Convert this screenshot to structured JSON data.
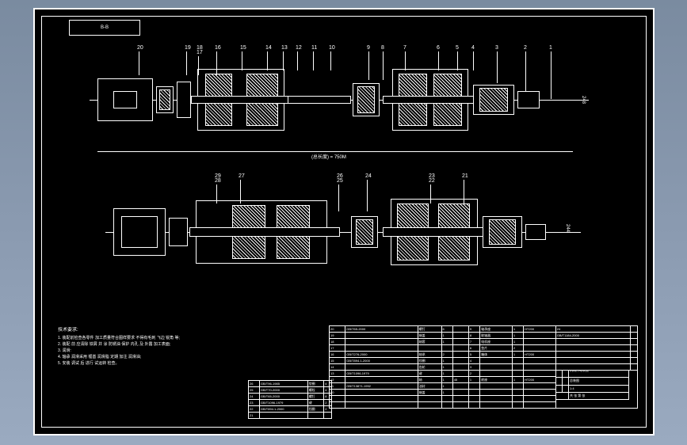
{
  "title_box": "B-B",
  "callouts_top": [
    "20",
    "19",
    "18",
    "17",
    "16",
    "15",
    "14",
    "13",
    "12",
    "11",
    "10",
    "9",
    "8",
    "7",
    "6",
    "5",
    "4",
    "3",
    "2",
    "1"
  ],
  "callouts_bottom": [
    "29",
    "28",
    "27",
    "26",
    "25",
    "24",
    "23",
    "22",
    "21"
  ],
  "dimension_label_top": "(总长度) = 750M",
  "right_dim_top": "248",
  "right_dim_bottom": "244",
  "notes_header": "技术要求:",
  "notes": [
    "1. 装配前检查各零件 加工质量符合图样要求 不得有毛刺 飞边 锐角 等;",
    "2. 装配 前 应清除 铁屑 并 涂 防锈油 保护 内孔 及 外露 加工表面;",
    "3. 润滑:",
    "4. 轴承 润滑采用 锂基 润滑脂 定期 加注 润滑油;",
    "5. 安装 调试 后 进行 试运转 检查。"
  ],
  "bom_left": [
    {
      "no": "26",
      "std": "GB/T96-1985",
      "name": "垫圈",
      "qty": "4"
    },
    {
      "no": "25",
      "std": "GB/T70-2000",
      "name": "螺栓",
      "qty": "4"
    },
    {
      "no": "24",
      "std": "GB/T65-2000",
      "name": "螺钉",
      "qty": "8"
    },
    {
      "no": "23",
      "std": "GB/T1096-1979",
      "name": "键",
      "qty": "2"
    },
    {
      "no": "22",
      "std": "GB/T894.1-2000",
      "name": "挡圈",
      "qty": "2"
    },
    {
      "no": "21",
      "std": "",
      "name": "",
      "qty": ""
    }
  ],
  "bom_main": [
    {
      "no": "20",
      "std": "GB/T65-2000",
      "name": "螺钉",
      "qty": "6",
      "mat": "",
      "note": ""
    },
    {
      "no": "19",
      "std": "",
      "name": "端盖",
      "qty": "1",
      "mat": "",
      "note": ""
    },
    {
      "no": "18",
      "std": "",
      "name": "轴套",
      "qty": "1",
      "mat": "",
      "note": ""
    },
    {
      "no": "17",
      "std": "",
      "name": "",
      "qty": "",
      "mat": "",
      "note": ""
    },
    {
      "no": "16",
      "std": "GB/T276-2000",
      "name": "轴承",
      "qty": "2",
      "mat": "",
      "note": ""
    },
    {
      "no": "15",
      "std": "GB/T894.1-2000",
      "name": "挡圈",
      "qty": "1",
      "mat": "",
      "note": ""
    },
    {
      "no": "14",
      "std": "",
      "name": "齿轮",
      "qty": "1",
      "mat": "45",
      "note": ""
    },
    {
      "no": "13",
      "std": "GB/T1096-1979",
      "name": "键",
      "qty": "1",
      "mat": "",
      "note": ""
    },
    {
      "no": "12",
      "std": "",
      "name": "轴",
      "qty": "1",
      "mat": "45",
      "note": ""
    },
    {
      "no": "11",
      "std": "GB/T13871-1992",
      "name": "油封",
      "qty": "1",
      "mat": "",
      "note": ""
    },
    {
      "no": "10",
      "std": "",
      "name": "端盖",
      "qty": "1",
      "mat": "",
      "note": ""
    }
  ],
  "bom_right": [
    {
      "no": "9",
      "name": "轴承座",
      "qty": "1",
      "mat": "HT200"
    },
    {
      "no": "8",
      "name": "联轴器",
      "qty": "1",
      "mat": ""
    },
    {
      "no": "7",
      "name": "电机座",
      "qty": "1",
      "mat": ""
    },
    {
      "no": "6",
      "name": "垫片",
      "qty": "2",
      "mat": ""
    },
    {
      "no": "5",
      "name": "箱体",
      "qty": "1",
      "mat": "HT200"
    },
    {
      "no": "4",
      "name": "",
      "qty": "",
      "mat": ""
    },
    {
      "no": "3",
      "name": "",
      "qty": "",
      "mat": ""
    },
    {
      "no": "2",
      "name": "",
      "qty": "",
      "mat": ""
    },
    {
      "no": "1",
      "name": "底座",
      "qty": "1",
      "mat": "HT200"
    }
  ],
  "bom_far_right": [
    {
      "a": "",
      "b": "24",
      "c": "",
      "d": ""
    },
    {
      "a": "GB/T1184-2000",
      "b": "",
      "c": "",
      "d": ""
    },
    {
      "a": "",
      "b": "",
      "c": "",
      "d": ""
    },
    {
      "a": "",
      "b": "",
      "c": "",
      "d": ""
    }
  ],
  "title_block": {
    "project": "机械传动装置",
    "drawing": "总装图",
    "scale": "1:4",
    "sheet": "共 张 第 张"
  }
}
